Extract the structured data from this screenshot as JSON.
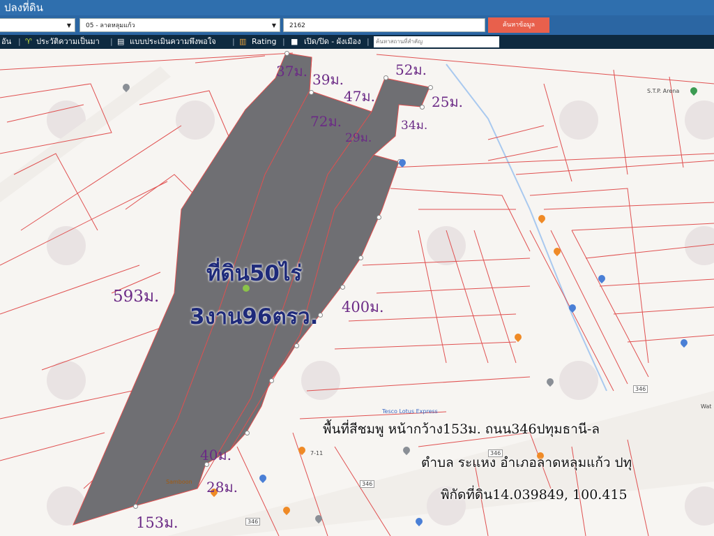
{
  "header": {
    "title": "ปลงที่ดิน"
  },
  "search": {
    "province_value": "",
    "district_value": "05 - ลาดหลุมแก้ว",
    "parcel_value": "2162",
    "button_label": "ค้นหาข้อมูล"
  },
  "toolbar": {
    "item0": "อัน",
    "item1": "ประวัติความเป็นมา",
    "item2": "แบบประเมินความพึงพอใจ",
    "item3": "Rating",
    "item4": "เปิด/ปิด - ผังเมือง",
    "search_placeholder": "ค้นหาสถานที่สำคัญ"
  },
  "map": {
    "parcel_color": "#6f6f73",
    "line_color": "#e05050",
    "area_line1": "ที่ดิน50ไร่",
    "area_line2": "3งาน96ตรว.",
    "measurements": {
      "m37": "37ม.",
      "m39": "39ม.",
      "m52": "52ม.",
      "m47": "47ม.",
      "m25": "25ม.",
      "m72": "72ม.",
      "m34": "34ม.",
      "m29": "29ม.",
      "m593": "593ม.",
      "m400": "400ม.",
      "m40": "40ม.",
      "m28": "28ม.",
      "m153": "153ม."
    },
    "caption_line1": "พื้นที่สีชมพู หน้ากว้าง153ม. ถนน346ปทุมธานี-ล",
    "caption_line2": "ตำบล ระแหง อำเภอลาดหลุมแก้ว ปทุ",
    "caption_line3": "พิกัดที่ดิน14.039849, 100.415",
    "poi": {
      "stp": "S.T.P. Arena",
      "tesco": "Tesco Lotus Express",
      "seveneleven": "7-11",
      "samboon": "Samboon",
      "road346a": "346",
      "road346b": "346",
      "road346c": "346",
      "road346d": "346",
      "wat": "Wat"
    }
  }
}
